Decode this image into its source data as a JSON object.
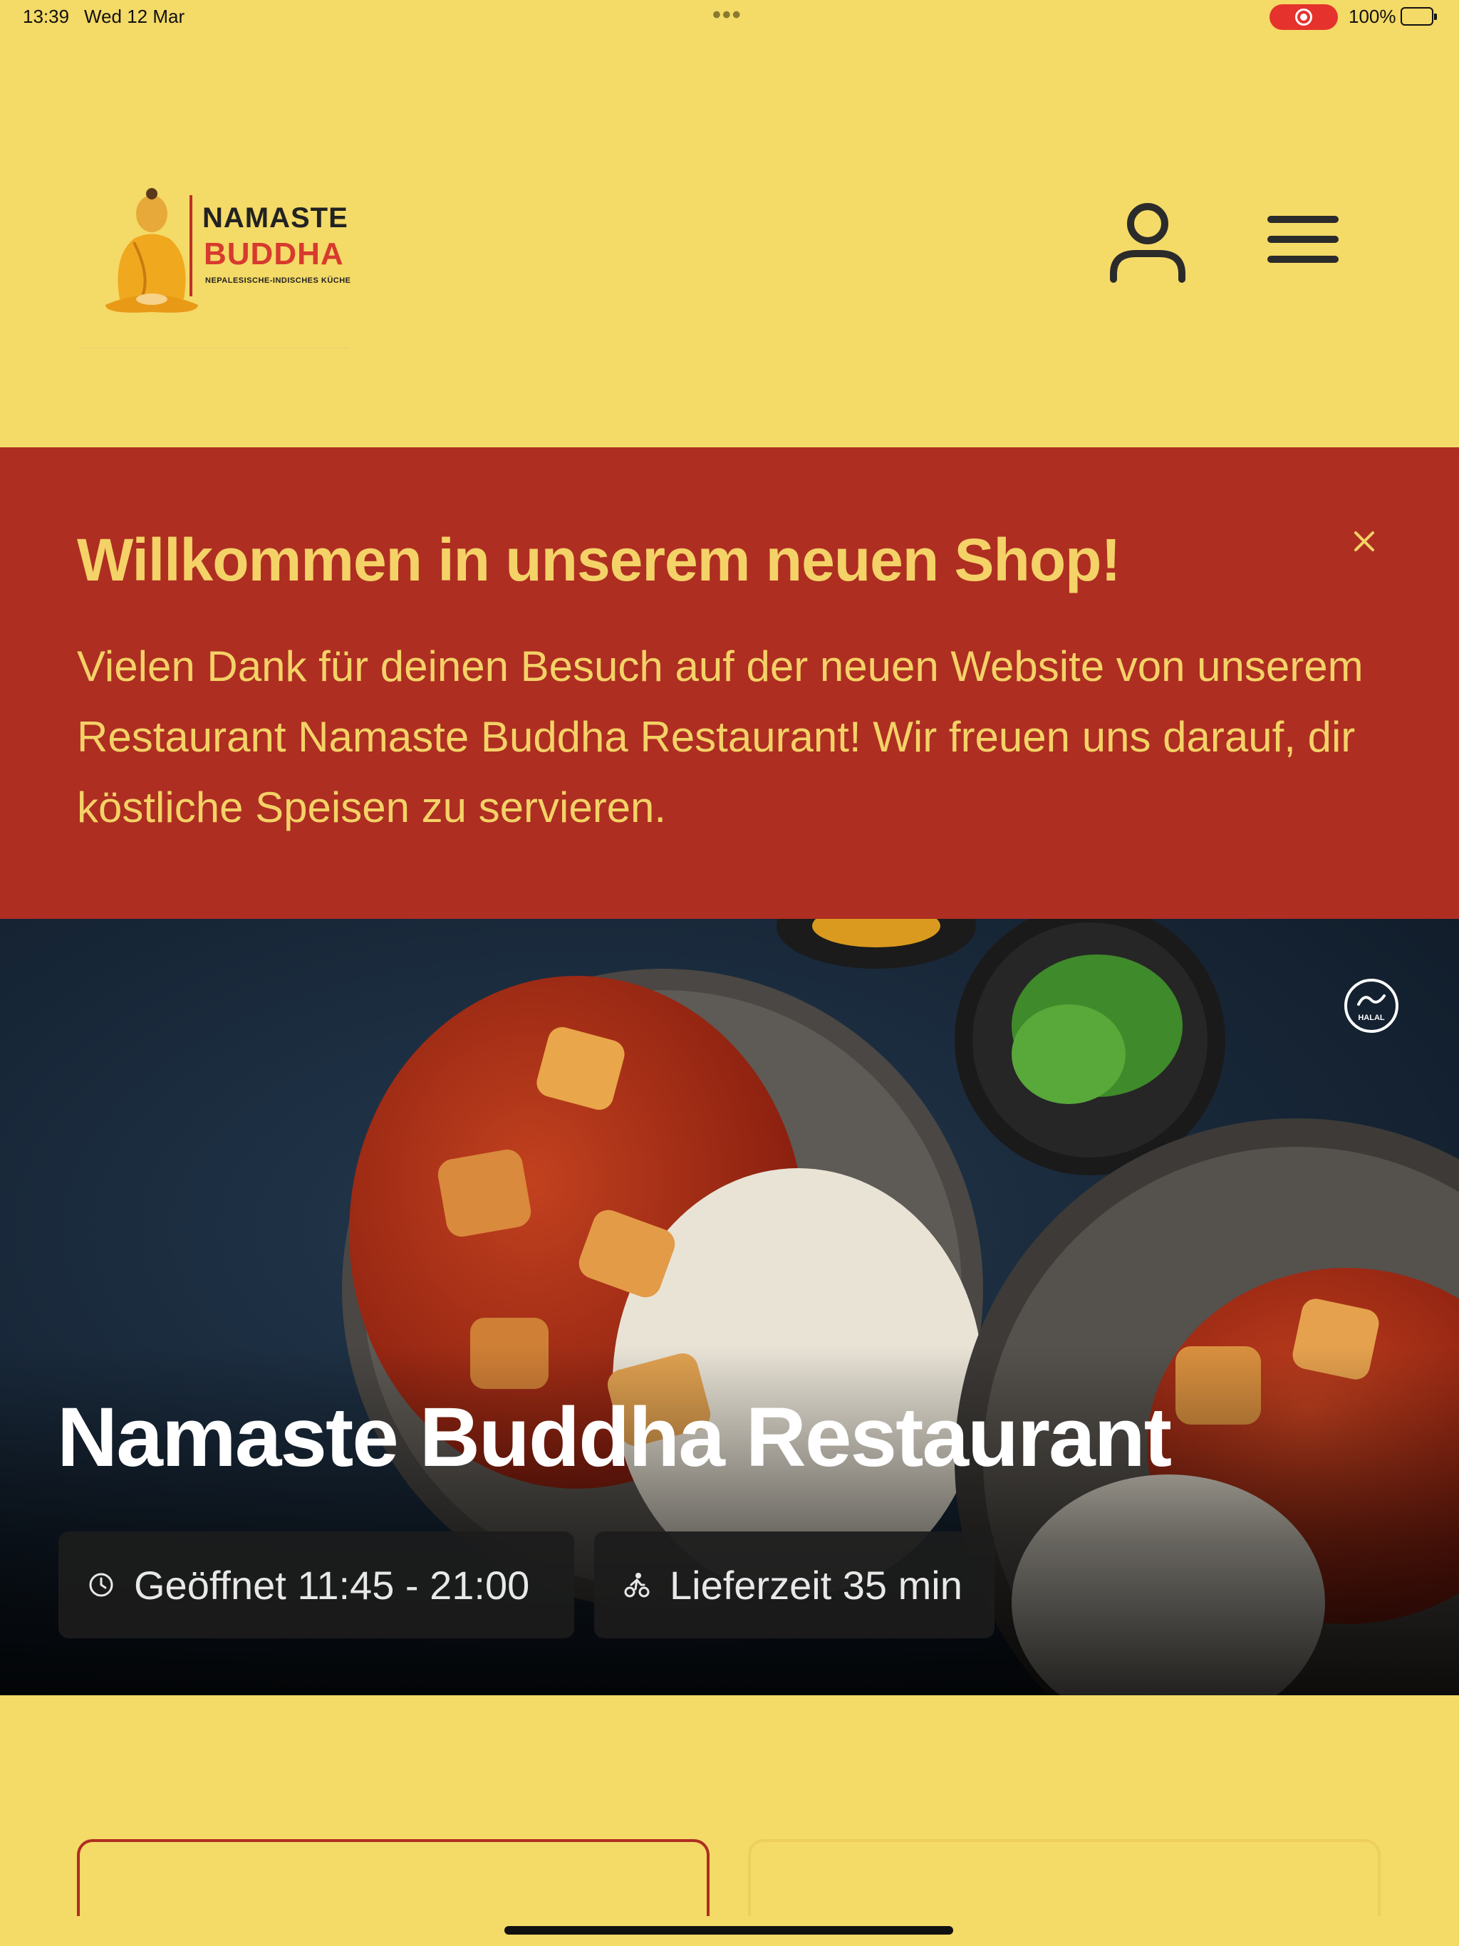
{
  "status_bar": {
    "time": "13:39",
    "date": "Wed 12 Mar",
    "battery": "100%"
  },
  "header": {
    "logo_line1": "NAMASTE",
    "logo_line2": "BUDDHA",
    "logo_tagline": "NEPALESISCHE-INDISCHES KÜCHE"
  },
  "banner": {
    "title": "Willkommen in unserem neuen Shop!",
    "body": "Vielen Dank für deinen Besuch auf der neuen Website von unserem Restaurant Namaste Buddha Restaurant! Wir freuen uns darauf, dir köstliche Speisen zu servieren."
  },
  "hero": {
    "title": "Namaste Buddha Restaurant",
    "open_hours": "Geöffnet 11:45 - 21:00",
    "delivery_time": "Lieferzeit 35 min",
    "badge": "HALAL"
  },
  "colors": {
    "background": "#F4DA67",
    "banner": "#AE2E22",
    "banner_text": "#F4D267",
    "chip": "#1C1C1C"
  }
}
